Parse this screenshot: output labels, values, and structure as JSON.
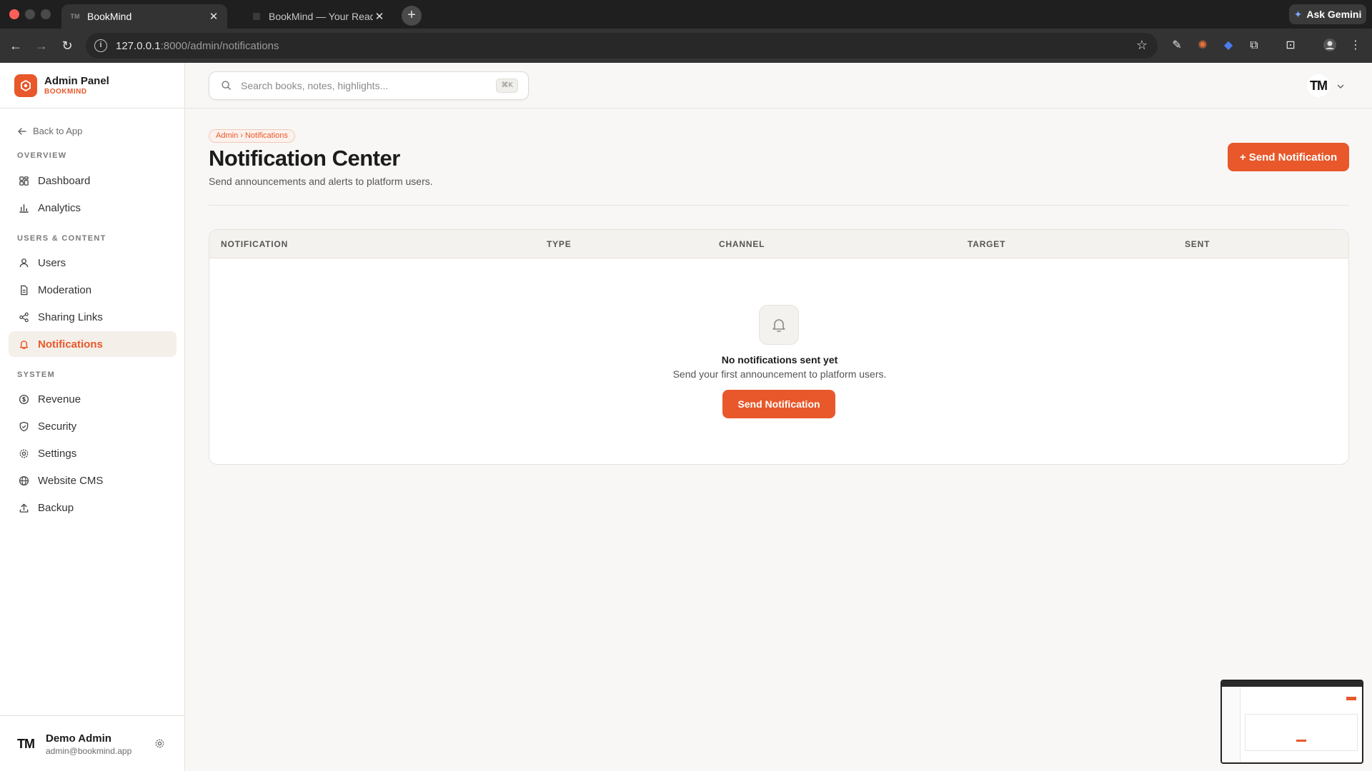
{
  "browser": {
    "tabs": [
      {
        "title": "BookMind",
        "favicon": "TM",
        "active": true
      },
      {
        "title": "BookMind — Your Reading Lif",
        "active": false
      }
    ],
    "gemini_label": "Ask Gemini",
    "url_host": "127.0.0.1",
    "url_rest": ":8000/admin/notifications"
  },
  "sidebar": {
    "brand_title": "Admin Panel",
    "brand_sub": "BOOKMIND",
    "back_label": "Back to App",
    "sections": {
      "overview": "OVERVIEW",
      "users_content": "USERS & CONTENT",
      "system": "SYSTEM"
    },
    "items": {
      "dashboard": "Dashboard",
      "analytics": "Analytics",
      "users": "Users",
      "moderation": "Moderation",
      "sharing_links": "Sharing Links",
      "notifications": "Notifications",
      "revenue": "Revenue",
      "security": "Security",
      "settings": "Settings",
      "website_cms": "Website CMS",
      "backup": "Backup"
    },
    "active_item": "notifications",
    "user": {
      "initials": "TM",
      "name": "Demo Admin",
      "email": "admin@bookmind.app"
    }
  },
  "topbar": {
    "search_placeholder": "Search books, notes, highlights...",
    "search_shortcut": "⌘K",
    "avatar_initials": "TM"
  },
  "page": {
    "breadcrumb": "Admin › Notifications",
    "title": "Notification Center",
    "description": "Send announcements and alerts to platform users.",
    "primary_button": "+ Send Notification"
  },
  "table": {
    "columns": [
      "NOTIFICATION",
      "TYPE",
      "CHANNEL",
      "TARGET",
      "SENT"
    ],
    "rows": [],
    "empty_title": "No notifications sent yet",
    "empty_description": "Send your first announcement to platform users.",
    "empty_button": "Send Notification"
  },
  "colors": {
    "accent": "#e8582a",
    "sidebar_active_bg": "#f4efe9",
    "page_bg": "#f8f7f5"
  }
}
